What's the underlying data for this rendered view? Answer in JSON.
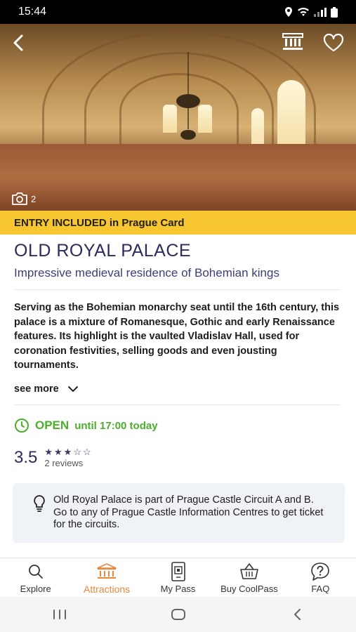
{
  "status_bar": {
    "time": "15:44"
  },
  "hero": {
    "photo_count": "2"
  },
  "banner": {
    "text": "ENTRY INCLUDED in Prague Card"
  },
  "place": {
    "title": "OLD ROYAL PALACE",
    "subtitle": "Impressive medieval residence of Bohemian kings",
    "description": "Serving as the Bohemian monarchy seat until the 16th century, this palace is a mixture of Romanesque, Gothic and early Renaissance features. Its highlight is the vaulted Vladislav Hall, used for coronation festivities, selling goods and even jousting tournaments.",
    "see_more": "see more"
  },
  "hours": {
    "status": "OPEN",
    "until": "until 17:00 today"
  },
  "rating": {
    "value": "3.5",
    "stars_filled": 3,
    "stars_total": 5,
    "reviews": "2 reviews"
  },
  "info": {
    "text": "Old Royal Palace is part of Prague Castle Circuit A and B. Go to any of Prague Castle Information Centres to get ticket for the circuits."
  },
  "tabs": [
    {
      "label": "Explore",
      "icon": "search-icon"
    },
    {
      "label": "Attractions",
      "icon": "museum-icon",
      "active": true
    },
    {
      "label": "My Pass",
      "icon": "qr-pass-icon"
    },
    {
      "label": "Buy CoolPass",
      "icon": "basket-icon"
    },
    {
      "label": "FAQ",
      "icon": "help-icon"
    }
  ],
  "colors": {
    "accent_yellow": "#f7c630",
    "open_green": "#4caf2a",
    "title_navy": "#2a2b5e",
    "active_tab": "#e8873a"
  }
}
